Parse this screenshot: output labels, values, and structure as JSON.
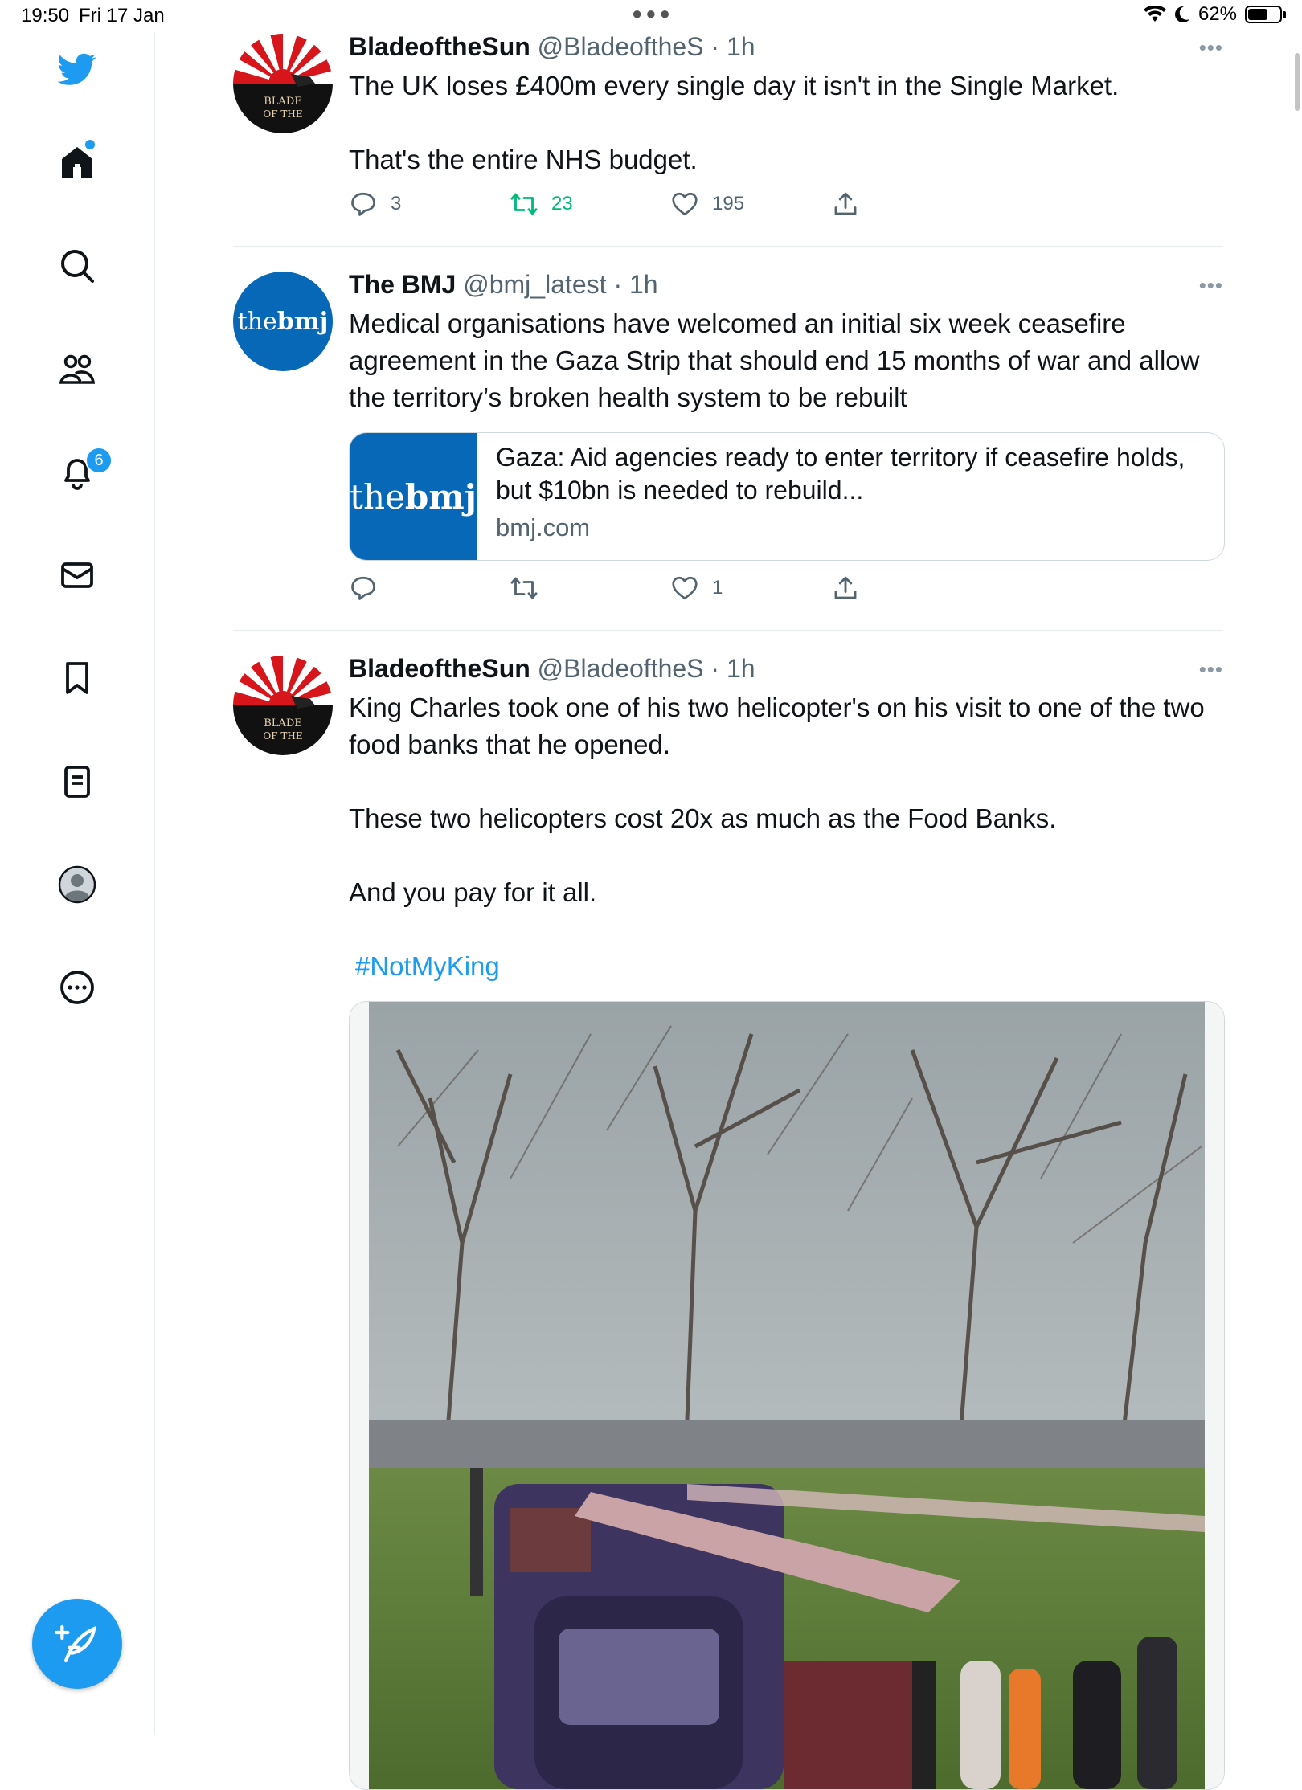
{
  "status_bar": {
    "time": "19:50",
    "date": "Fri 17 Jan",
    "battery": "62%",
    "battery_level": 0.62
  },
  "sidebar": {
    "notification_count": "6",
    "items": [
      {
        "name": "home",
        "icon": "home-icon"
      },
      {
        "name": "explore",
        "icon": "search-icon"
      },
      {
        "name": "communities",
        "icon": "people-icon"
      },
      {
        "name": "notifications",
        "icon": "bell-icon"
      },
      {
        "name": "messages",
        "icon": "envelope-icon"
      },
      {
        "name": "bookmarks",
        "icon": "bookmark-icon"
      },
      {
        "name": "lists",
        "icon": "list-icon"
      },
      {
        "name": "profile",
        "icon": "profile-icon"
      },
      {
        "name": "more",
        "icon": "more-circle-icon"
      }
    ],
    "compose_icon": "feather-plus-icon",
    "accent": "#1d9bf0"
  },
  "tweets": [
    {
      "name": "BladeoftheSun",
      "handle": "@BladeoftheS",
      "sep": " · ",
      "time": "1h",
      "paragraphs": [
        "The UK loses £400m every single day it isn't in the Single Market.",
        "That's the entire NHS budget."
      ],
      "replies": "3",
      "retweets": "23",
      "likes": "195",
      "avatar_text_1": "BLADE",
      "avatar_text_2": "OF THE"
    },
    {
      "name": "The BMJ",
      "handle": "@bmj_latest",
      "sep": " · ",
      "time": "1h",
      "paragraphs": [
        "Medical organisations have welcomed an initial six week ceasefire agreement in the Gaza Strip that should end 15 months of war and allow the territory’s broken health system to be rebuilt"
      ],
      "replies": "",
      "retweets": "",
      "likes": "1",
      "avatar_logo_1": "the",
      "avatar_logo_2": "bmj",
      "card": {
        "title": "Gaza: Aid agencies ready to enter territory if ceasefire holds, but $10bn is needed to rebuild...",
        "domain": "bmj.com",
        "logo_1": "the",
        "logo_2": "bmj"
      }
    },
    {
      "name": "BladeoftheSun",
      "handle": "@BladeoftheS",
      "sep": " · ",
      "time": "1h",
      "paragraphs": [
        "King Charles took one of his two helicopter's on his visit to one of the two food banks that he opened.",
        "These two helicopters cost 20x as much as the Food Banks.",
        "And you pay for it all."
      ],
      "hashtag": "#NotMyKing",
      "avatar_text_1": "BLADE",
      "avatar_text_2": "OF THE"
    }
  ],
  "colors": {
    "accent": "#1d9bf0",
    "retweet_green": "#00ba7c",
    "secondary_text": "#536471",
    "bmj_blue": "#0868b8"
  }
}
